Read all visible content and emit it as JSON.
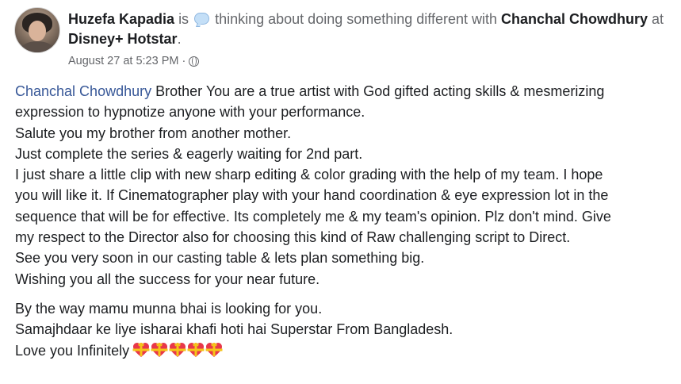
{
  "header": {
    "author": "Huzefa Kapadia",
    "is_text": "is",
    "activity_icon": "thought-bubble-icon",
    "activity_text": "thinking about doing something different with",
    "tagged_person": "Chanchal Chowdhury",
    "at_text": "at",
    "place": "Disney+ Hotstar",
    "period": "."
  },
  "meta": {
    "timestamp": "August 27 at 5:23 PM",
    "separator": "·",
    "privacy_icon": "globe-icon"
  },
  "post": {
    "mention": "Chanchal Chowdhury",
    "lines": [
      " Brother You are a true artist with God gifted acting skills & mesmerizing",
      "expression to hypnotize anyone with your performance.",
      "Salute you my brother from another mother.",
      "Just complete the series & eagerly waiting for 2nd part.",
      "I just share a little clip with new sharp editing & color grading with the help of my team. I hope",
      "you will like it. If Cinematographer play with your hand coordination & eye expression lot in the",
      "sequence that will be for effective. Its completely me & my team's opinion. Plz don't mind. Give",
      "my respect to the Director also for choosing this kind of Raw challenging script to Direct.",
      "See you very soon in our casting table & lets plan something big.",
      "Wishing you all the success for your near future.",
      "By the way mamu munna bhai is looking for you.",
      "Samajhdaar ke liye isharai khafi hoti hai Superstar From Bangladesh.",
      "Love you Infinitely"
    ],
    "emoji_icon": "heart-with-ribbon-emoji",
    "emoji_count": 5
  },
  "colors": {
    "mention": "#385898",
    "text": "#1c1e21",
    "muted": "#65676b",
    "heart": "#e8374a",
    "ribbon": "#f5c518"
  }
}
